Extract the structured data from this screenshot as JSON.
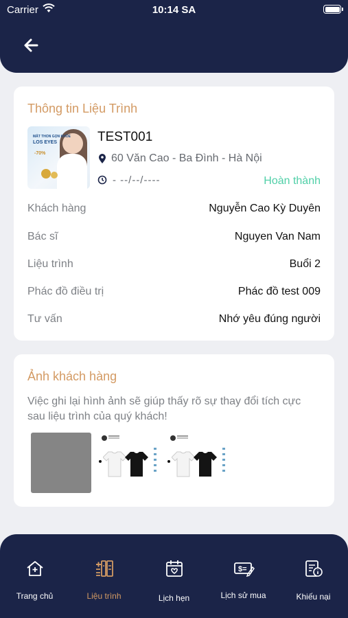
{
  "status_bar": {
    "carrier": "Carrier",
    "time": "10:14 SA"
  },
  "header": {
    "back_icon": "arrow-left-icon"
  },
  "treatment_info": {
    "title": "Thông tin Liệu Trình",
    "thumbnail_text": {
      "line1": "MẮT THON GỌN KHỎE",
      "line2": "LOS EYES",
      "line3": "-70%"
    },
    "code": "TEST001",
    "address": "60 Văn Cao - Ba Đình - Hà Nội",
    "date": "- --/--/----",
    "status": "Hoàn thành",
    "status_color": "#4fcfa7",
    "rows": [
      {
        "label": "Khách hàng",
        "value": "Nguyễn Cao Kỳ Duyên"
      },
      {
        "label": "Bác sĩ",
        "value": "Nguyen Van Nam"
      },
      {
        "label": "Liệu trình",
        "value": "Buổi 2"
      },
      {
        "label": "Phác đồ điều trị",
        "value": "Phác đồ test 009"
      },
      {
        "label": "Tư vấn",
        "value": "Nhớ yêu đúng người"
      }
    ]
  },
  "customer_photos": {
    "title": "Ảnh khách hàng",
    "description": "Việc ghi lại hình ảnh sẽ giúp thấy rõ sự thay đổi tích cực sau liệu trình của quý khách!"
  },
  "tab_bar": {
    "active_color": "#d39a63",
    "items": [
      {
        "label": "Trang chủ",
        "icon": "home-icon",
        "active": false
      },
      {
        "label": "Liệu trình",
        "icon": "treatment-icon",
        "active": true
      },
      {
        "label": "Lịch hẹn",
        "icon": "calendar-icon",
        "active": false
      },
      {
        "label": "Lịch sử mua",
        "icon": "purchase-history-icon",
        "active": false
      },
      {
        "label": "Khiếu nại",
        "icon": "complaint-icon",
        "active": false
      }
    ]
  }
}
